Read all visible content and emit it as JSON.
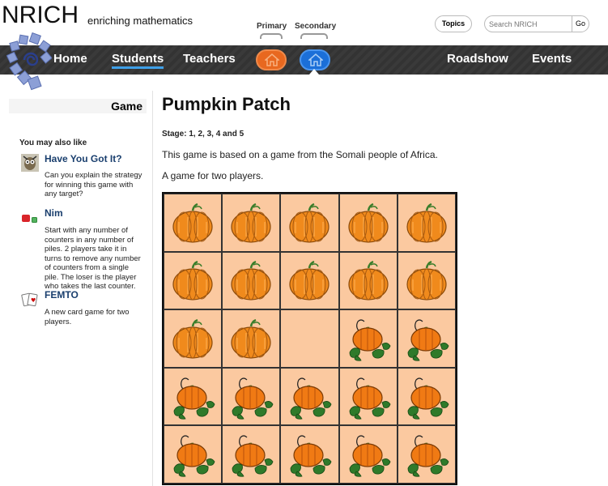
{
  "header": {
    "brand": "NRICH",
    "tagline": "enriching mathematics",
    "audience_primary": "Primary",
    "audience_secondary": "Secondary",
    "topics_label": "Topics",
    "search_placeholder": "Search NRICH",
    "go_label": "Go"
  },
  "nav": {
    "items": [
      "Home",
      "Students",
      "Teachers",
      "Roadshow",
      "Events"
    ],
    "active": "Students",
    "accent_color": "#3fa0e8",
    "primary_color": "#e8681f",
    "secondary_color": "#1b6fd8"
  },
  "sidebar": {
    "heading": "Game",
    "also_like": "You may also like",
    "related": [
      {
        "title": "Have You Got It?",
        "description": "Can you explain the strategy for winning this game with any target?",
        "icon": "owl-icon"
      },
      {
        "title": "Nim",
        "description": "Start with any number of counters in any number of piles. 2 players take it in turns to remove any number of counters from a single pile. The loser is the player who takes the last counter.",
        "icon": "counters-icon"
      },
      {
        "title": "FEMTO",
        "description": "A new card game for two players.",
        "icon": "cards-icon"
      }
    ]
  },
  "main": {
    "title": "Pumpkin Patch",
    "stage": "Stage: 1, 2, 3, 4 and 5",
    "paragraphs": [
      "This game is based on a game from the Somali people of Africa.",
      "A game for two players."
    ],
    "board": {
      "rows": 5,
      "cols": 5,
      "cells": [
        [
          "pumpkin-a",
          "pumpkin-a",
          "pumpkin-a",
          "pumpkin-a",
          "pumpkin-a"
        ],
        [
          "pumpkin-a",
          "pumpkin-a",
          "pumpkin-a",
          "pumpkin-a",
          "pumpkin-a"
        ],
        [
          "pumpkin-a",
          "pumpkin-a",
          "empty",
          "pumpkin-b",
          "pumpkin-b"
        ],
        [
          "pumpkin-b",
          "pumpkin-b",
          "pumpkin-b",
          "pumpkin-b",
          "pumpkin-b"
        ],
        [
          "pumpkin-b",
          "pumpkin-b",
          "pumpkin-b",
          "pumpkin-b",
          "pumpkin-b"
        ]
      ],
      "board_color": "#fbc9a0"
    }
  }
}
